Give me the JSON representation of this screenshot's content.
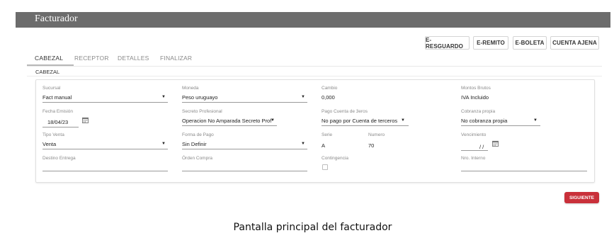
{
  "app": {
    "title": "Facturador"
  },
  "toolbar": {
    "buttons": [
      "E-RESGUARDO",
      "E-REMITO",
      "E-BOLETA",
      "CUENTA AJENA"
    ]
  },
  "tabs": [
    "CABEZAL",
    "RECEPTOR",
    "DETALLES",
    "FINALIZAR"
  ],
  "section": {
    "label": "CABEZAL"
  },
  "form": {
    "sucursal": {
      "label": "Sucursal",
      "value": "Fact manual"
    },
    "moneda": {
      "label": "Moneda",
      "value": "Peso uruguayo"
    },
    "cambio": {
      "label": "Cambio",
      "value": "0,000"
    },
    "montos_brutos": {
      "label": "Montos Brutos",
      "value": "IVA Incluido"
    },
    "fecha_emision": {
      "label": "Fecha Emisión",
      "value": "18/04/23"
    },
    "secreto_profesional": {
      "label": "Secreto Profesional",
      "value": "Operacion No Amparada Secreto Prof"
    },
    "pago_cuenta_terceros": {
      "label": "Pago Cuenta de 3eros",
      "value": "No pago por Cuenta de terceros"
    },
    "cobranza_propia": {
      "label": "Cobranza propia",
      "value": "No cobranza propia"
    },
    "tipo_venta": {
      "label": "Tipo Venta",
      "value": "Venta"
    },
    "forma_pago": {
      "label": "Forma de Pago",
      "value": "Sin Definir"
    },
    "serie": {
      "label": "Serie",
      "value": "A"
    },
    "numero": {
      "label": "Numero",
      "value": "70"
    },
    "vencimiento": {
      "label": "Vencimiento",
      "value": "/ /"
    },
    "destino_entrega": {
      "label": "Destino Entrega",
      "value": ""
    },
    "orden_compra": {
      "label": "Órden Compra",
      "value": ""
    },
    "contingencia": {
      "label": "Contingencia",
      "checked": false
    },
    "nro_interno": {
      "label": "Nro. Interno",
      "value": ""
    }
  },
  "actions": {
    "next": "SIGUIENTE"
  },
  "caption": "Pantalla principal del facturador",
  "colors": {
    "titlebar": "#6c6c6c",
    "primary_button": "#c9303a"
  },
  "icons": {
    "date": "calendar-icon",
    "select": "caret-down-icon"
  }
}
